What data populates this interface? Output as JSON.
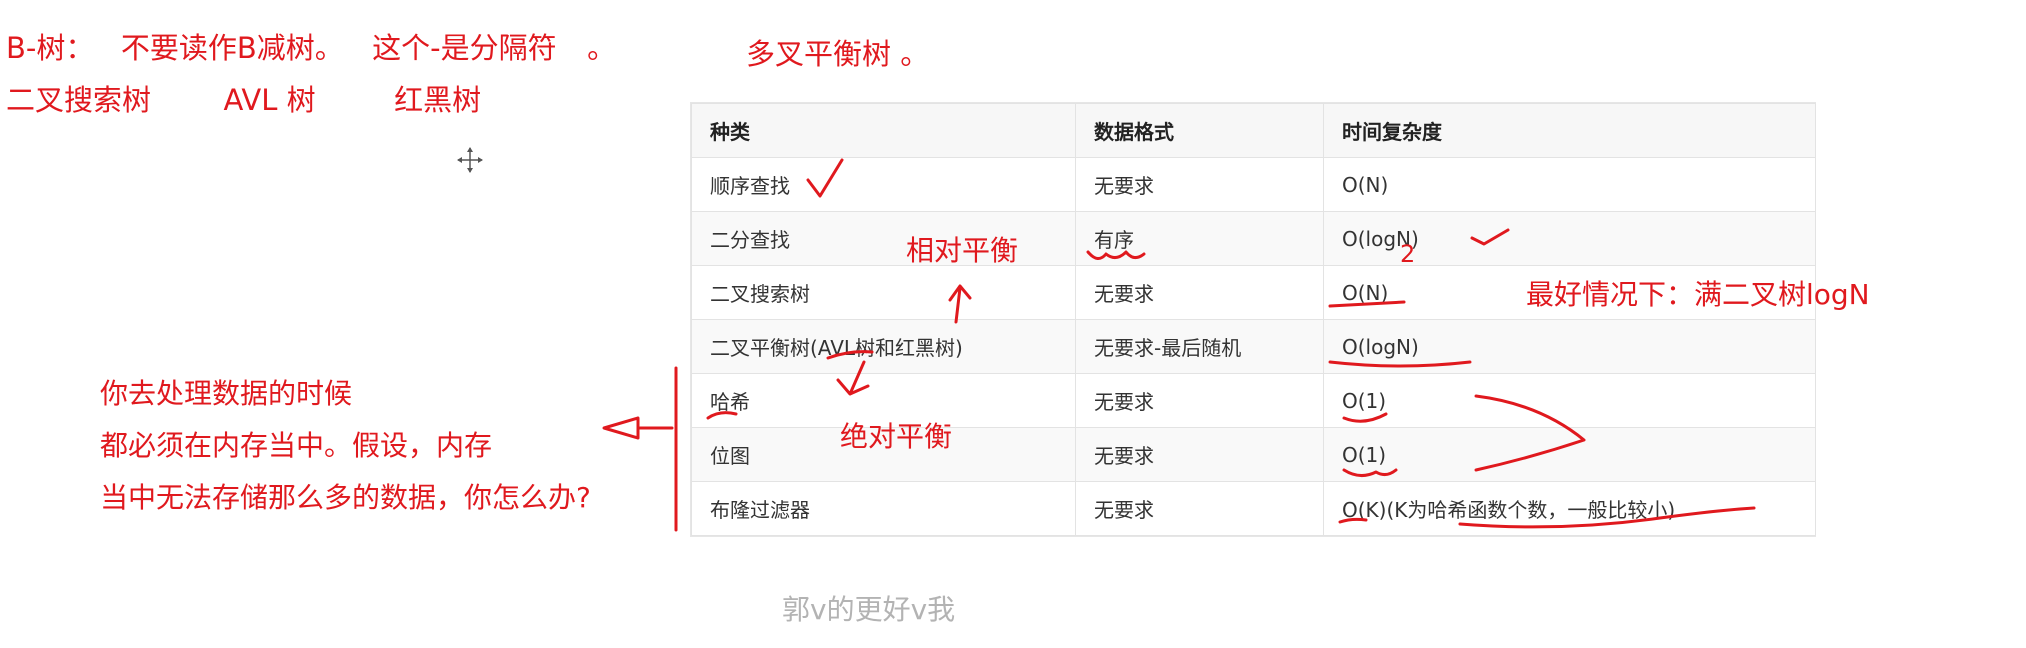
{
  "notes": {
    "line1_a": "B-树：",
    "line1_b": "不要读作B减树。",
    "line1_c": "这个-是分隔符",
    "line1_d": "。",
    "line2_a": "二叉搜索树",
    "line2_b": "AVL 树",
    "line2_c": "红黑树",
    "title": "多叉平衡树 。"
  },
  "left_note": {
    "line1": "你去处理数据的时候",
    "line2": "都必须在内存当中。假设，内存",
    "line3": "当中无法存储那么多的数据，你怎么办?"
  },
  "table": {
    "headers": [
      "种类",
      "数据格式",
      "时间复杂度"
    ],
    "rows": [
      [
        "顺序查找",
        "无要求",
        "O(N)"
      ],
      [
        "二分查找",
        "有序",
        "O(logN)"
      ],
      [
        "二叉搜索树",
        "无要求",
        "O(N)"
      ],
      [
        "二叉平衡树(AVL树和红黑树)",
        "无要求-最后随机",
        "O(logN)"
      ],
      [
        "哈希",
        "无要求",
        "O(1)"
      ],
      [
        "位图",
        "无要求",
        "O(1)"
      ],
      [
        "布隆过滤器",
        "无要求",
        "O(K)(K为哈希函数个数，一般比较小)"
      ]
    ]
  },
  "annotations": {
    "relative_balance": "相对平衡",
    "absolute_balance": "绝对平衡",
    "best_case": "最好情况下：满二叉树logN",
    "log_base": "2"
  },
  "footer": "郭v的更好v我",
  "colors": {
    "annotation": "#e0191e",
    "table_header_bg": "#f7f7f7",
    "table_border": "#e3e3e3",
    "footer": "#b3b3b3"
  },
  "icons": {
    "cursor": "crosshair-move-icon"
  }
}
